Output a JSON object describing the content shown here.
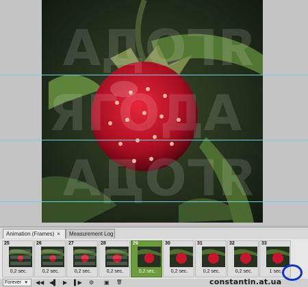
{
  "canvas": {
    "overlay_word": "ЯГОДА"
  },
  "panel": {
    "tabs": [
      {
        "label": "Animation (Frames)",
        "close": "×"
      },
      {
        "label": "Measurement Log"
      }
    ],
    "frames": [
      {
        "number": "25",
        "delay": "0,2 sec."
      },
      {
        "number": "26",
        "delay": "0,2 sec."
      },
      {
        "number": "27",
        "delay": "0,2 sec."
      },
      {
        "number": "28",
        "delay": "0,2 sec."
      },
      {
        "number": "29",
        "delay": "0,2 sec.",
        "selected": true
      },
      {
        "number": "30",
        "delay": "0,2 sec."
      },
      {
        "number": "31",
        "delay": "0,2 sec."
      },
      {
        "number": "32",
        "delay": "0,2 sec."
      },
      {
        "number": "33",
        "delay": "1 sec."
      }
    ],
    "toolbar": {
      "loop": "Forever",
      "loop_arrow": "▼",
      "first": "◀◀",
      "prev": "◀▌",
      "play": "▶",
      "next": "▌▶",
      "tween": "⚙",
      "duplicate": "▣",
      "delete": "🗑"
    }
  },
  "watermark": "constantin.at.ua"
}
